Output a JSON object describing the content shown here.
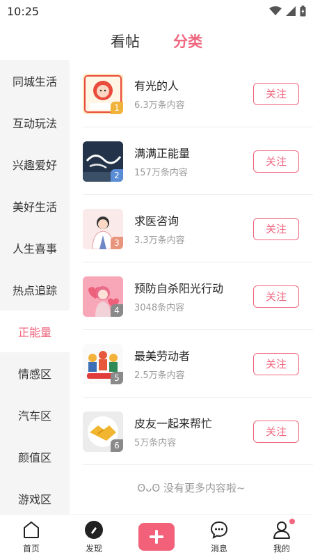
{
  "status": {
    "time": "10:25"
  },
  "top_tabs": [
    {
      "label": "看帖",
      "active": false
    },
    {
      "label": "分类",
      "active": true
    }
  ],
  "sidebar": [
    {
      "label": "同城生活"
    },
    {
      "label": "互动玩法"
    },
    {
      "label": "兴趣爱好"
    },
    {
      "label": "美好生活"
    },
    {
      "label": "人生喜事"
    },
    {
      "label": "热点追踪"
    },
    {
      "label": "正能量",
      "active": true
    },
    {
      "label": "情感区"
    },
    {
      "label": "汽车区"
    },
    {
      "label": "颜值区"
    },
    {
      "label": "游戏区"
    }
  ],
  "topics": [
    {
      "name": "有光的人",
      "count": "6.3万条内容",
      "rank": "1",
      "follow": "关注"
    },
    {
      "name": "满满正能量",
      "count": "157万条内容",
      "rank": "2",
      "follow": "关注"
    },
    {
      "name": "求医咨询",
      "count": "3.3万条内容",
      "rank": "3",
      "follow": "关注"
    },
    {
      "name": "预防自杀阳光行动",
      "count": "3048条内容",
      "rank": "4",
      "follow": "关注"
    },
    {
      "name": "最美劳动者",
      "count": "2.5万条内容",
      "rank": "5",
      "follow": "关注"
    },
    {
      "name": "皮友一起来帮忙",
      "count": "5万条内容",
      "rank": "6",
      "follow": "关注"
    }
  ],
  "no_more": "ʘᴗʘ 没有更多内容啦~",
  "bottom_nav": [
    {
      "label": "首页",
      "icon": "home-icon"
    },
    {
      "label": "发现",
      "icon": "compass-icon"
    },
    {
      "label": "",
      "icon": "plus-icon"
    },
    {
      "label": "消息",
      "icon": "message-icon"
    },
    {
      "label": "我的",
      "icon": "user-icon"
    }
  ],
  "colors": {
    "accent": "#f0667e"
  }
}
